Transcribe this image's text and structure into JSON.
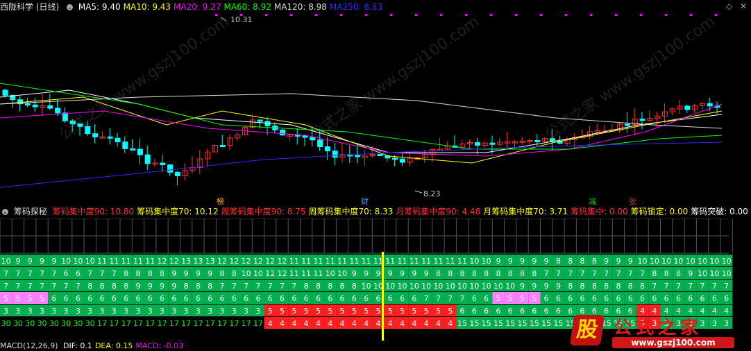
{
  "header": {
    "title": "西陇科学 (日线)",
    "ma": [
      {
        "label": "MA5: 9.40",
        "color": "#ffffff"
      },
      {
        "label": "MA10: 9.43",
        "color": "#ffff00"
      },
      {
        "label": "MA20: 9.27",
        "color": "#ff00ff"
      },
      {
        "label": "MA60: 8.92",
        "color": "#00ff00"
      },
      {
        "label": "MA120: 8.98",
        "color": "#dddddd"
      },
      {
        "label": "MA250: 8.83",
        "color": "#2b2bff"
      }
    ]
  },
  "price_chart": {
    "high_label": "10.31",
    "low_label": "8.23",
    "markers": [
      {
        "text": "榜",
        "color": "#ffb000"
      },
      {
        "text": "财",
        "color": "#4aa0ff"
      },
      {
        "text": "减",
        "color": "#00d000"
      },
      {
        "text": "张",
        "color": "#ff2020"
      }
    ]
  },
  "chip_header": {
    "title": "筹码探秘",
    "items": [
      {
        "label": "筹码集中度90: 10.80",
        "color": "#ff3030"
      },
      {
        "label": "筹码集中度70: 10.12",
        "color": "#ffff00"
      },
      {
        "label": "周筹码集中度90: 8.75",
        "color": "#ff3030"
      },
      {
        "label": "周筹码集中度70: 8.33",
        "color": "#ffff00"
      },
      {
        "label": "月筹码集中度90: 4.48",
        "color": "#ff3030"
      },
      {
        "label": "月筹码集中度70: 3.71",
        "color": "#ffff00"
      },
      {
        "label": "筹码集中: 0.00",
        "color": "#ff3030"
      },
      {
        "label": "筹码锁定: 0.00",
        "color": "#ffff00"
      },
      {
        "label": "筹码突破: 0.00",
        "color": "#ffffff"
      },
      {
        "label": "寻底指",
        "color": "#ffff00"
      }
    ]
  },
  "macd_header": {
    "title": "MACD(12,26,9)",
    "items": [
      {
        "label": "DIF: 0.1",
        "color": "#ffffff"
      },
      {
        "label": "DEA: 0.15",
        "color": "#ffff00"
      },
      {
        "label": "MACD: -0.03",
        "color": "#ff00ff"
      }
    ]
  },
  "chip_rows": {
    "row1": [
      "10",
      "9",
      "9",
      "9",
      "9",
      "10",
      "10",
      "10",
      "11",
      "11",
      "11",
      "11",
      "11",
      "12",
      "12",
      "13",
      "13",
      "13",
      "12",
      "12",
      "12",
      "12",
      "12",
      "12",
      "11",
      "11",
      "11",
      "11",
      "11",
      "11",
      "11",
      "11",
      "11",
      "11",
      "11",
      "11",
      "11",
      "11",
      "11",
      "10",
      "10",
      "9",
      "9",
      "9",
      "9",
      "9",
      "8",
      "8",
      "8",
      "8",
      "9",
      "9",
      "9",
      "10",
      "10",
      "10",
      "10",
      "10",
      "10",
      "10",
      "10"
    ],
    "row2": [
      "7",
      "7",
      "7",
      "7",
      "7",
      "6",
      "6",
      "7",
      "7",
      "7",
      "8",
      "8",
      "8",
      "8",
      "9",
      "9",
      "9",
      "9",
      "8",
      "8",
      "10",
      "10",
      "12",
      "12",
      "11",
      "11",
      "11",
      "10",
      "10",
      "9",
      "9",
      "9",
      "9",
      "9",
      "9",
      "9",
      "8",
      "8",
      "8",
      "8",
      "8",
      "8",
      "8",
      "8",
      "8",
      "7",
      "7",
      "7",
      "7",
      "7",
      "7",
      "7",
      "7",
      "7",
      "8",
      "8",
      "8",
      "9",
      "10",
      "10",
      "10"
    ],
    "row3": [
      "7",
      "7",
      "7",
      "7",
      "7",
      "7",
      "7",
      "8",
      "8",
      "8",
      "8",
      "9",
      "9",
      "9",
      "9",
      "8",
      "8",
      "8",
      "7",
      "7",
      "7",
      "7",
      "7",
      "7",
      "7",
      "8",
      "8",
      "8",
      "8",
      "8",
      "10",
      "10",
      "10",
      "10",
      "10",
      "10",
      "10",
      "10",
      "10",
      "10",
      "10",
      "10",
      "10",
      "9",
      "9",
      "9",
      "9",
      "8",
      "8",
      "8",
      "8",
      "8",
      "8",
      "8",
      "7",
      "7",
      "7",
      "7",
      "7",
      "7",
      "7"
    ],
    "row4": [
      "5",
      "5",
      "5",
      "5",
      "6",
      "6",
      "6",
      "6",
      "6",
      "6",
      "6",
      "6",
      "6",
      "6",
      "6",
      "6",
      "6",
      "6",
      "6",
      "6",
      "6",
      "6",
      "6",
      "6",
      "6",
      "6",
      "6",
      "6",
      "6",
      "6",
      "6",
      "6",
      "6",
      "6",
      "6",
      "7",
      "7",
      "7",
      "7",
      "6",
      "6",
      "5",
      "5",
      "5",
      "5",
      "6",
      "6",
      "6",
      "6",
      "6",
      "6",
      "6",
      "6",
      "6",
      "6",
      "6",
      "6",
      "6",
      "6",
      "6",
      "6"
    ],
    "row5": [
      "3",
      "3",
      "3",
      "3",
      "3",
      "3",
      "3",
      "3",
      "3",
      "3",
      "3",
      "3",
      "3",
      "3",
      "3",
      "3",
      "3",
      "3",
      "3",
      "3",
      "3",
      "3",
      "5",
      "5",
      "5",
      "5",
      "5",
      "5",
      "5",
      "5",
      "5",
      "5",
      "5",
      "5",
      "5",
      "5",
      "5",
      "5",
      "6",
      "6",
      "6",
      "6",
      "6",
      "6",
      "6",
      "6",
      "6",
      "6",
      "6",
      "6",
      "6",
      "6",
      "6",
      "4",
      "4",
      "4",
      "4",
      "4",
      "4",
      "4",
      "4"
    ],
    "row6": [
      "30",
      "30",
      "30",
      "30",
      "30",
      "30",
      "30",
      "30",
      "17",
      "17",
      "17",
      "17",
      "17",
      "17",
      "17",
      "17",
      "17",
      "17",
      "17",
      "17",
      "17",
      "17",
      "4",
      "4",
      "4",
      "4",
      "4",
      "4",
      "4",
      "4",
      "4",
      "4",
      "4",
      "4",
      "4",
      "4",
      "4",
      "4",
      "15",
      "15",
      "15",
      "15",
      "15",
      "15",
      "15",
      "15",
      "15",
      "15",
      "15",
      "15",
      "15",
      "15",
      "15",
      "3",
      "3",
      "3",
      "3",
      "3",
      "3",
      "3",
      "3"
    ]
  },
  "logo": {
    "text": "公式之家",
    "url": "www.gszj100.com",
    "badge": "股"
  },
  "watermark": "公式之家 www.gszj100.com"
}
